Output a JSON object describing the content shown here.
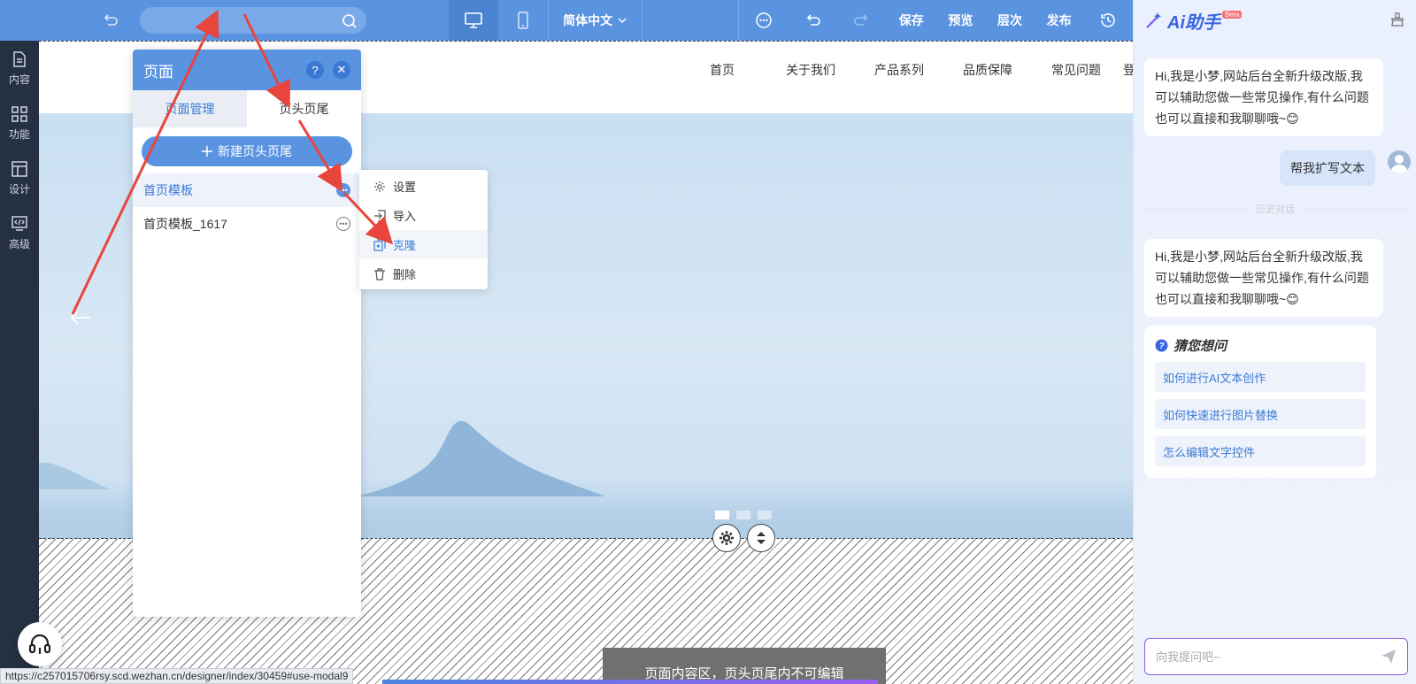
{
  "topbar": {
    "search_placeholder": "",
    "language": "简体中文",
    "save": "保存",
    "preview": "预览",
    "layers": "层次",
    "publish": "发布"
  },
  "leftbar": {
    "items": [
      {
        "label": "内容",
        "icon": "file-icon"
      },
      {
        "label": "功能",
        "icon": "grid-icon"
      },
      {
        "label": "设计",
        "icon": "layout-icon"
      },
      {
        "label": "高级",
        "icon": "code-icon"
      }
    ]
  },
  "site": {
    "nav": [
      "首页",
      "关于我们",
      "产品系列",
      "品质保障",
      "常见问题",
      "登"
    ]
  },
  "page_panel": {
    "title": "页面",
    "help": "?",
    "close": "✕",
    "tabs": [
      "页面管理",
      "页头页尾"
    ],
    "new_button": "新建页头页尾",
    "templates": [
      "首页模板",
      "首页模板_1617"
    ]
  },
  "context_menu": {
    "items": [
      "设置",
      "导入",
      "克隆",
      "删除"
    ]
  },
  "canvas": {
    "note": "页面内容区，页头页尾内不可编辑"
  },
  "ai": {
    "title": "Ai助手",
    "beta": "Beta",
    "greeting": "Hi,我是小梦,网站后台全新升级改版,我可以辅助您做一些常见操作,有什么问题也可以直接和我聊聊哦~😊",
    "user_message": "帮我扩写文本",
    "history_label": "历史对话",
    "greeting2": "Hi,我是小梦,网站后台全新升级改版,我可以辅助您做一些常见操作,有什么问题也可以直接和我聊聊哦~😊",
    "guess_title": "猜您想问",
    "guesses": [
      "如何进行AI文本创作",
      "如何快速进行图片替换",
      "怎么编辑文字控件"
    ],
    "input_placeholder": "向我提问吧~"
  },
  "status_url": "https://c257015706rsy.scd.wezhan.cn/designer/index/30459#use-modal9",
  "colors": {
    "topbar": "#5a93e0",
    "sidebar": "#253042",
    "accent": "#3a7bd5",
    "annotation_arrow": "#e8453c"
  }
}
